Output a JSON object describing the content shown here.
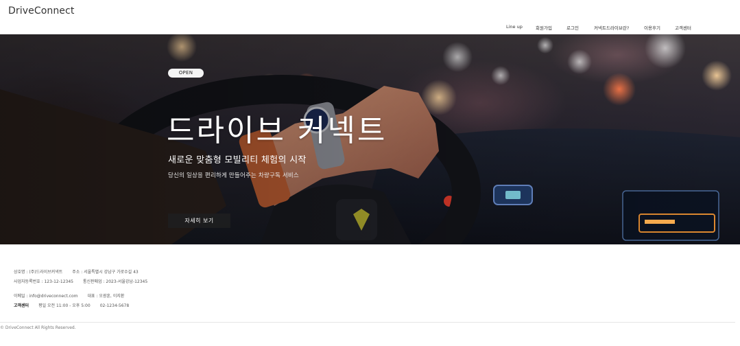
{
  "header": {
    "logo": "DriveConnect",
    "nav": [
      "Line up",
      "회원가입",
      "로그인",
      "커넥트드라이브란?",
      "이용후기",
      "고객센터"
    ]
  },
  "hero": {
    "badge": "OPEN",
    "title": "드라이브 커넥트",
    "subtitle": "새로운 맞춤형 모빌리티 체험의 시작",
    "description": "당신의 일상을 편리하게 만들어주는 차량구독 서비스",
    "button": "자세히 보기"
  },
  "footer": {
    "company": "상호명 : (주)드라이브커넥트",
    "address": "주소 : 서울특별시 강남구 가로수길 43",
    "business_no": "사업자등록번호 : 123-12-12345",
    "ecommerce_no": "통신판매업 : 2023-서울강남-12345",
    "email": "이메일 : info@driveconnect.com",
    "ceo": "대표 : 오광훈, 이지환",
    "cs_label": "고객센터",
    "cs_hours": "평일 오전 11:00 - 오후 5:00",
    "cs_phone": "02-1234-5678",
    "copyright": "© DriveConnect All Rights Reserved."
  }
}
